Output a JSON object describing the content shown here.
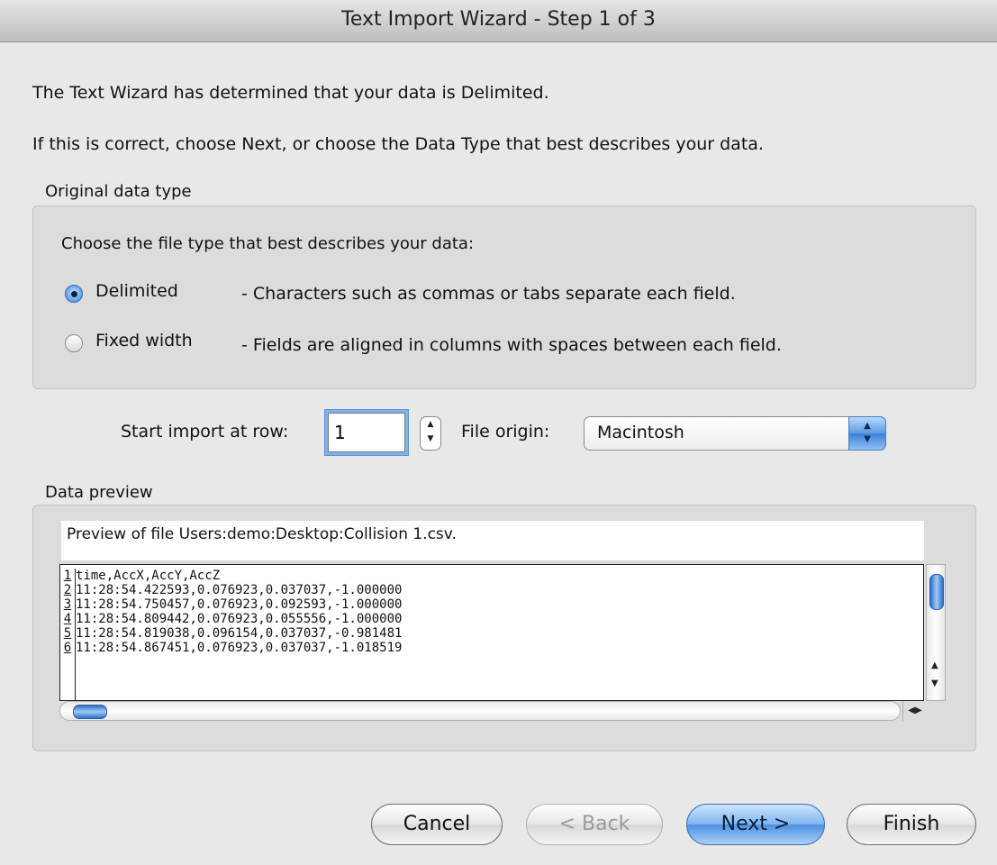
{
  "window": {
    "title": "Text Import Wizard - Step 1 of 3"
  },
  "intro": {
    "line1": "The Text Wizard has determined that your data is Delimited.",
    "line2": "If this is correct, choose Next, or choose the Data Type that best describes your data."
  },
  "original_type": {
    "group_label": "Original data type",
    "prompt": "Choose the file type that best describes your data:",
    "options": [
      {
        "label": "Delimited",
        "description": "- Characters such as commas or tabs separate each field.",
        "selected": true
      },
      {
        "label": "Fixed width",
        "description": "- Fields are aligned in columns with spaces between each field.",
        "selected": false
      }
    ]
  },
  "import_settings": {
    "start_row_label": "Start import at row:",
    "start_row_value": "1",
    "file_origin_label": "File origin:",
    "file_origin_value": "Macintosh"
  },
  "preview": {
    "group_label": "Data preview",
    "header": "Preview of file Users:demo:Desktop:Collision 1.csv.",
    "lines": [
      {
        "num": "1",
        "text": "time,AccX,AccY,AccZ"
      },
      {
        "num": "2",
        "text": "11:28:54.422593,0.076923,0.037037,-1.000000"
      },
      {
        "num": "3",
        "text": "11:28:54.750457,0.076923,0.092593,-1.000000"
      },
      {
        "num": "4",
        "text": "11:28:54.809442,0.076923,0.055556,-1.000000"
      },
      {
        "num": "5",
        "text": "11:28:54.819038,0.096154,0.037037,-0.981481"
      },
      {
        "num": "6",
        "text": "11:28:54.867451,0.076923,0.037037,-1.018519"
      }
    ]
  },
  "buttons": {
    "cancel": "Cancel",
    "back": "< Back",
    "next": "Next >",
    "finish": "Finish"
  },
  "icons": {
    "stepper": "stepper-arrows-icon",
    "select": "popup-arrows-icon",
    "scroll_up": "scroll-up-arrow-icon",
    "scroll_down": "scroll-down-arrow-icon",
    "scroll_left": "scroll-left-arrow-icon",
    "scroll_right": "scroll-right-arrow-icon"
  },
  "colors": {
    "accent": "#5b9ae3",
    "window_bg": "#e8e8e8",
    "group_bg": "#dcdcdc"
  }
}
